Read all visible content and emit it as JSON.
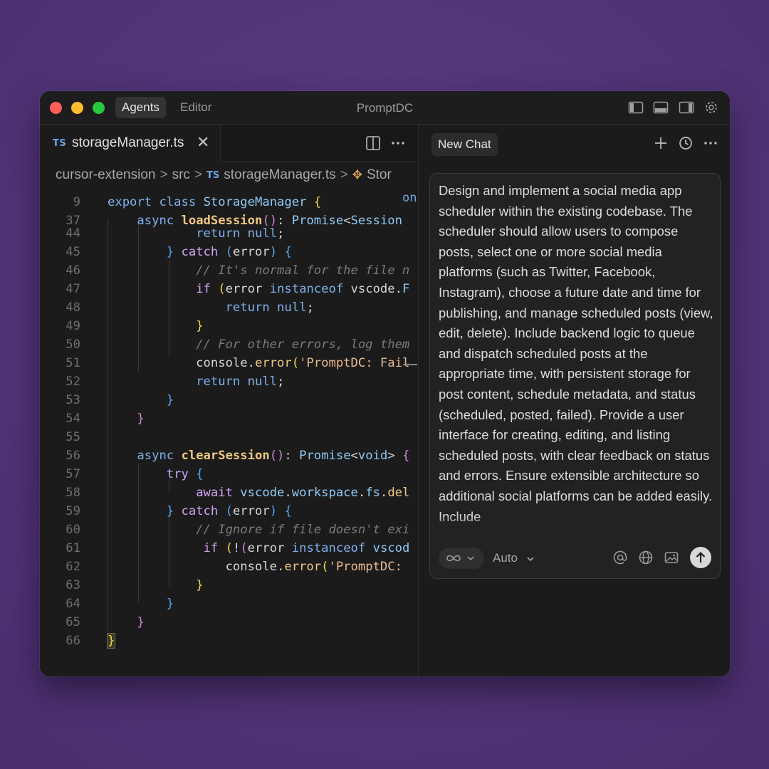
{
  "window": {
    "title": "PromptDC"
  },
  "mode_tabs": [
    {
      "label": "Agents",
      "active": true
    },
    {
      "label": "Editor",
      "active": false
    }
  ],
  "titlebar_icons": [
    "toggle-primary-sidebar-icon",
    "toggle-panel-icon",
    "toggle-secondary-sidebar-icon",
    "settings-gear-icon"
  ],
  "editor": {
    "tab": {
      "badge": "TS",
      "filename": "storageManager.ts",
      "close": "✕"
    },
    "actions": [
      "split-editor-icon",
      "more-actions-icon"
    ],
    "breadcrumb": {
      "items": [
        "cursor-extension",
        "src",
        "storageManager.ts",
        "Stor"
      ],
      "ts_badge": "TS",
      "separator": ">"
    },
    "overflow_label": "on",
    "line_numbers": [
      "9",
      "37",
      "44",
      "45",
      "46",
      "47",
      "48",
      "49",
      "50",
      "51",
      "52",
      "53",
      "54",
      "55",
      "56",
      "57",
      "58",
      "59",
      "60",
      "61",
      "62",
      "63",
      "64",
      "65",
      "66"
    ]
  },
  "chat": {
    "tab_label": "New Chat",
    "actions": [
      "new-chat-plus-icon",
      "history-clock-icon",
      "more-actions-icon"
    ],
    "prompt": "Design and implement a social media app scheduler within the existing codebase. The scheduler should allow users to compose posts, select one or more social media platforms (such as Twitter, Facebook, Instagram), choose a future date and time for publishing, and manage scheduled posts (view, edit, delete). Include backend logic to queue and dispatch scheduled posts at the appropriate time, with persistent storage for post content, schedule metadata, and status (scheduled, posted, failed). Provide a user interface for creating, editing, and listing scheduled posts, with clear feedback on status and errors. Ensure extensible architecture so additional social platforms can be added easily. Include",
    "mode_icon": "infinity-icon",
    "model_label": "Auto",
    "composer_icons": [
      "mention-at-icon",
      "web-globe-icon",
      "image-icon",
      "send-arrow-up-icon"
    ]
  },
  "colors": {
    "keyword": "#7fb0ec",
    "function": "#f0c77f",
    "comment": "#7b7b7b",
    "string": "#e9b98f",
    "accent_ts": "#6ea8e8"
  }
}
